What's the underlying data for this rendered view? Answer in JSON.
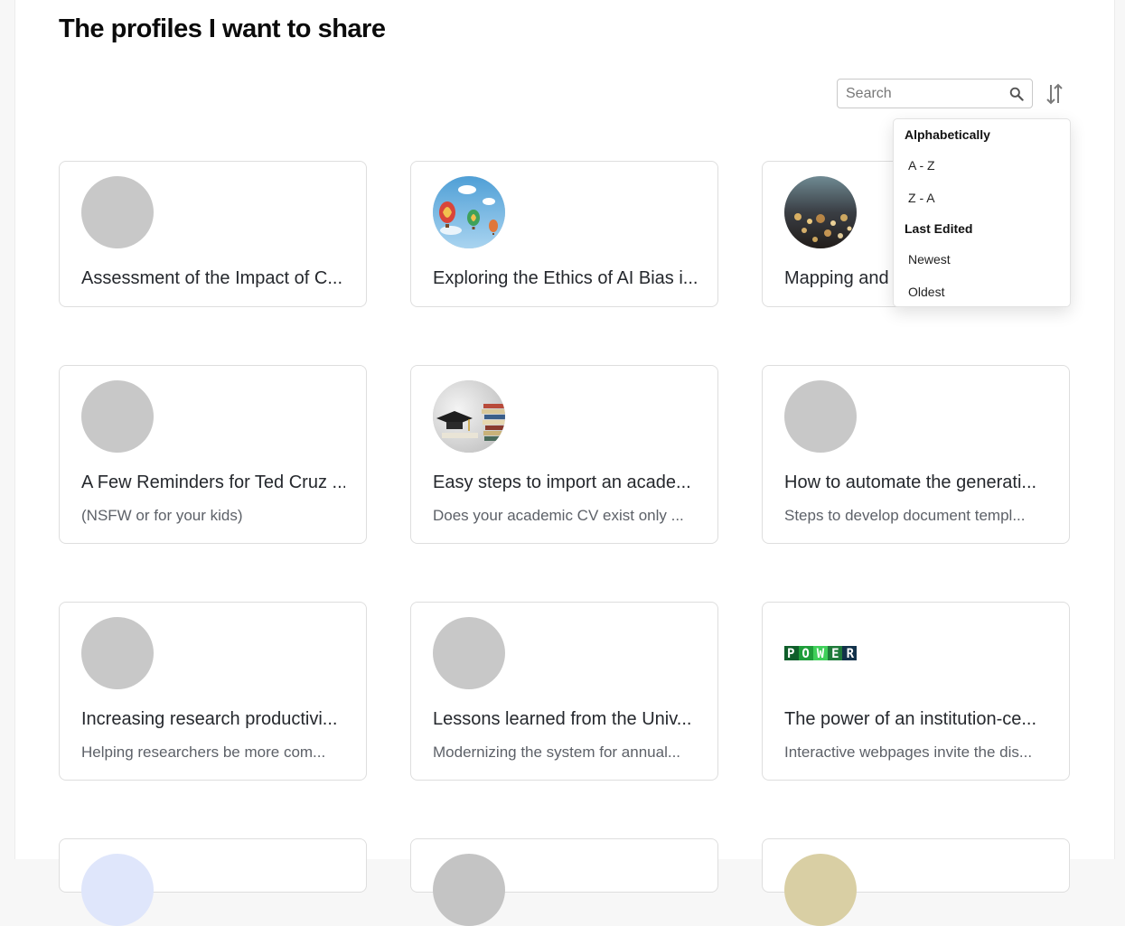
{
  "page": {
    "title": "The profiles I want to share"
  },
  "search": {
    "placeholder": "Search",
    "value": ""
  },
  "sort_menu": {
    "group1": "Alphabetically",
    "az": "A - Z",
    "za": "Z - A",
    "group2": "Last Edited",
    "newest": "Newest",
    "oldest": "Oldest"
  },
  "cards": [
    {
      "title": "Assessment of the Impact of C...",
      "subtitle": "",
      "image": "placeholder"
    },
    {
      "title": "Exploring the Ethics of AI Bias i...",
      "subtitle": "",
      "image": "hot-air-balloons"
    },
    {
      "title": "Mapping and",
      "subtitle": "",
      "image": "city-lights-bokeh"
    },
    {
      "title": "A Few Reminders for Ted Cruz ...",
      "subtitle": "(NSFW or for your kids)",
      "image": "placeholder"
    },
    {
      "title": "Easy steps to import an acade...",
      "subtitle": "Does your academic CV exist only ...",
      "image": "graduation-cap-books"
    },
    {
      "title": "How to automate the generati...",
      "subtitle": "Steps to develop document templ...",
      "image": "placeholder"
    },
    {
      "title": "Increasing research productivi...",
      "subtitle": "Helping researchers be more com...",
      "image": "placeholder"
    },
    {
      "title": "Lessons learned from the Univ...",
      "subtitle": "Modernizing the system for annual...",
      "image": "placeholder"
    },
    {
      "title": "The power of an institution-ce...",
      "subtitle": "Interactive webpages invite the dis...",
      "image": "power-logo",
      "logo_text": "POWER"
    }
  ],
  "colors": {
    "accent_green": "#1f9d3a",
    "placeholder_gray": "#c8c8c8"
  }
}
